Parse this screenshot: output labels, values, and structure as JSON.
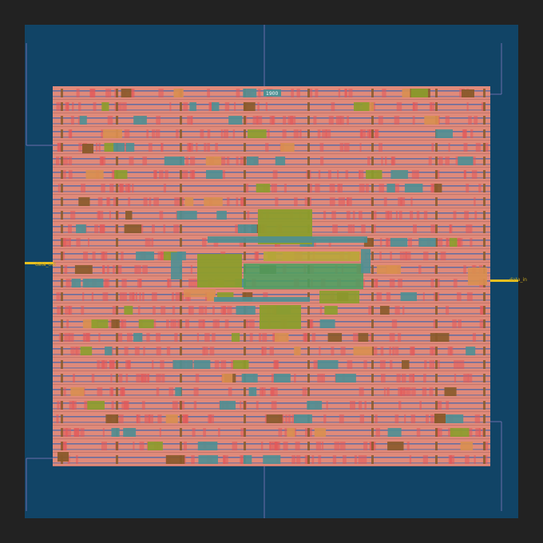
{
  "colors": {
    "frame": "#222222",
    "die": "#114466",
    "core": "#e08a7a",
    "row_stripe": "#4a66a8",
    "routing_hot": "#e45858",
    "cell_teal": "#4f8f93",
    "cell_orange": "#d98f50",
    "cell_olive": "#8c9d2c",
    "cell_brown": "#8a5a2a",
    "cell_green": "#4aa060",
    "pin_yellow": "#e8c020",
    "boundary": "#6c6caa"
  },
  "pins": {
    "data_out": "data_out",
    "data_in": "data_in"
  },
  "corner_labels": {
    "top_left": "",
    "top_mid": "",
    "bottom_left": "",
    "bottom_mid": "",
    "bottom_right": ""
  },
  "cell_label": "1900"
}
